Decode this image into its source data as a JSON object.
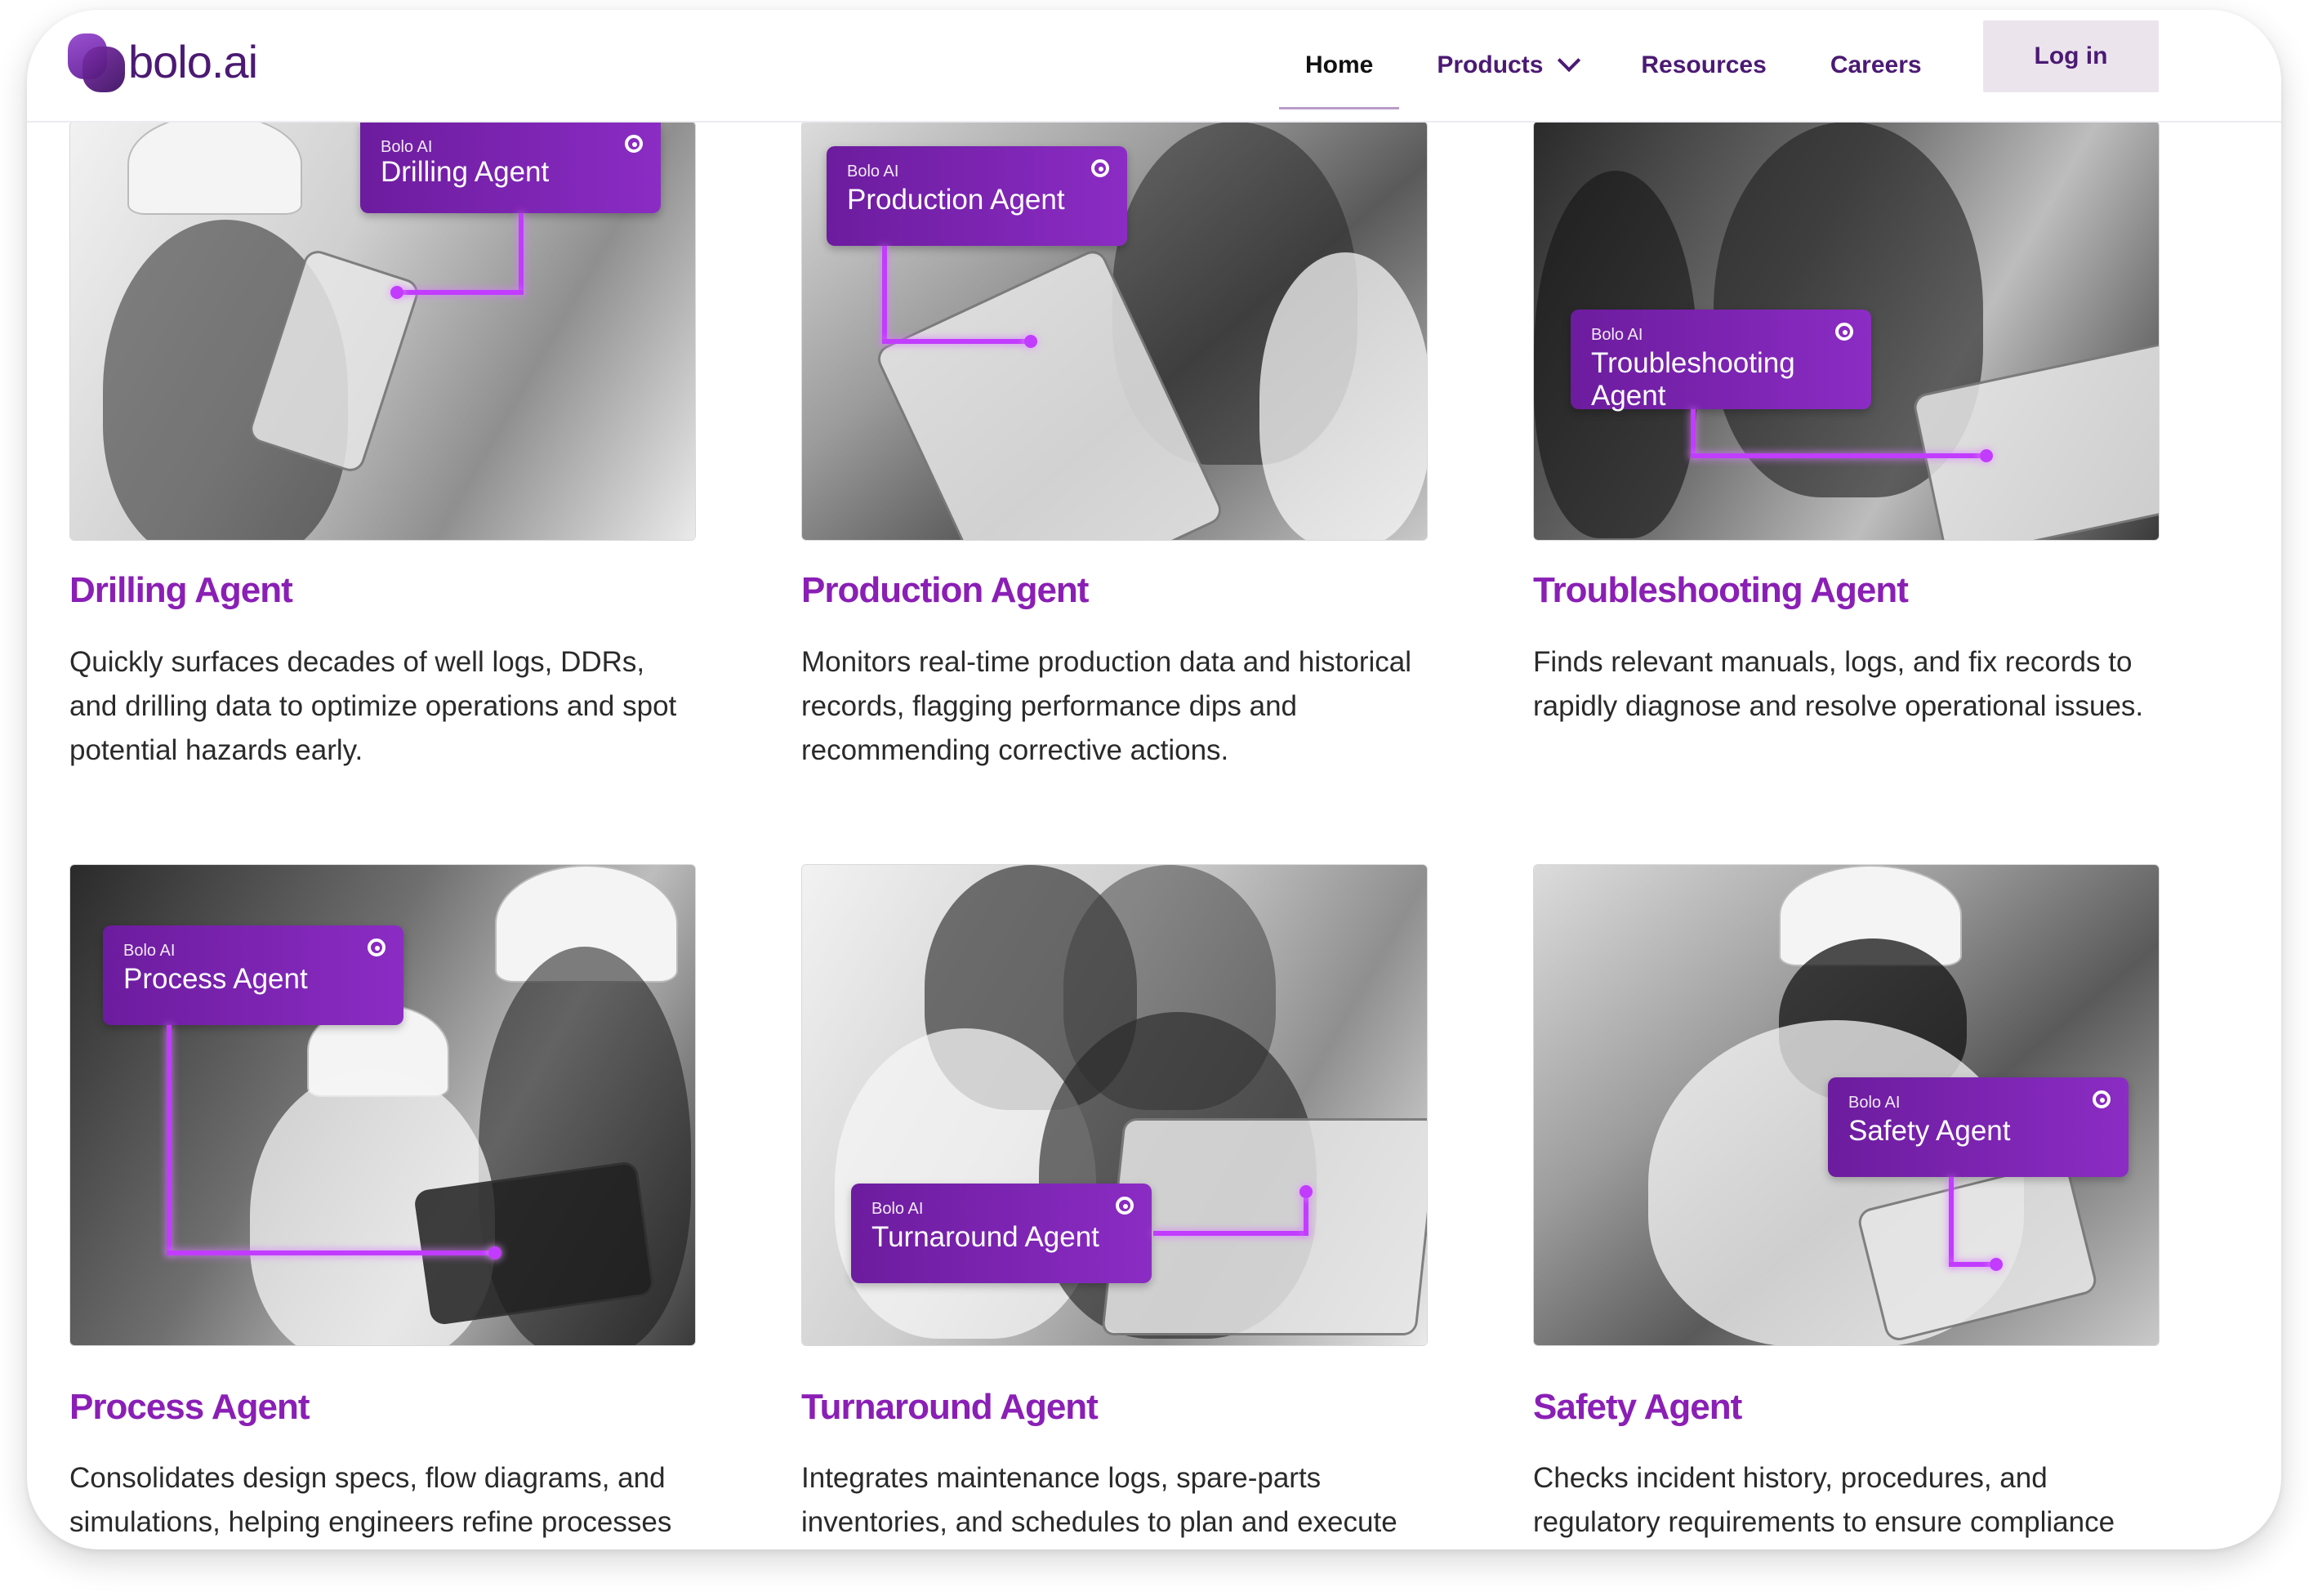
{
  "header": {
    "logo_text": "bolo",
    "logo_suffix": ".ai",
    "nav": {
      "home": "Home",
      "products": "Products",
      "resources": "Resources",
      "careers": "Careers"
    },
    "login": "Log in"
  },
  "agents": [
    {
      "tag_small": "Bolo AI",
      "tag_title": "Drilling Agent",
      "title": "Drilling Agent",
      "description": "Quickly surfaces decades of well logs, DDRs, and drilling data to optimize operations and spot potential hazards early."
    },
    {
      "tag_small": "Bolo AI",
      "tag_title": "Production Agent",
      "title": "Production Agent",
      "description": "Monitors real-time production data and historical records, flagging performance dips and recommending corrective actions."
    },
    {
      "tag_small": "Bolo AI",
      "tag_title": "Troubleshooting Agent",
      "title": "Troubleshooting Agent",
      "description": "Finds relevant manuals, logs, and fix records to rapidly diagnose and resolve operational issues."
    },
    {
      "tag_small": "Bolo AI",
      "tag_title": "Process Agent",
      "title": "Process Agent",
      "description": "Consolidates design specs, flow diagrams, and simulations, helping engineers refine processes"
    },
    {
      "tag_small": "Bolo AI",
      "tag_title": "Turnaround Agent",
      "title": "Turnaround Agent",
      "description": "Integrates maintenance logs, spare-parts inventories, and schedules to plan and execute"
    },
    {
      "tag_small": "Bolo AI",
      "tag_title": "Safety Agent",
      "title": "Safety Agent",
      "description": "Checks incident history, procedures, and regulatory requirements to ensure compliance"
    }
  ],
  "colors": {
    "brand": "#4b1a73",
    "accent": "#8a1fb5",
    "tag_gradient_start": "#6c1c9e",
    "tag_gradient_end": "#8b2cc4",
    "connector": "#c13cff"
  }
}
